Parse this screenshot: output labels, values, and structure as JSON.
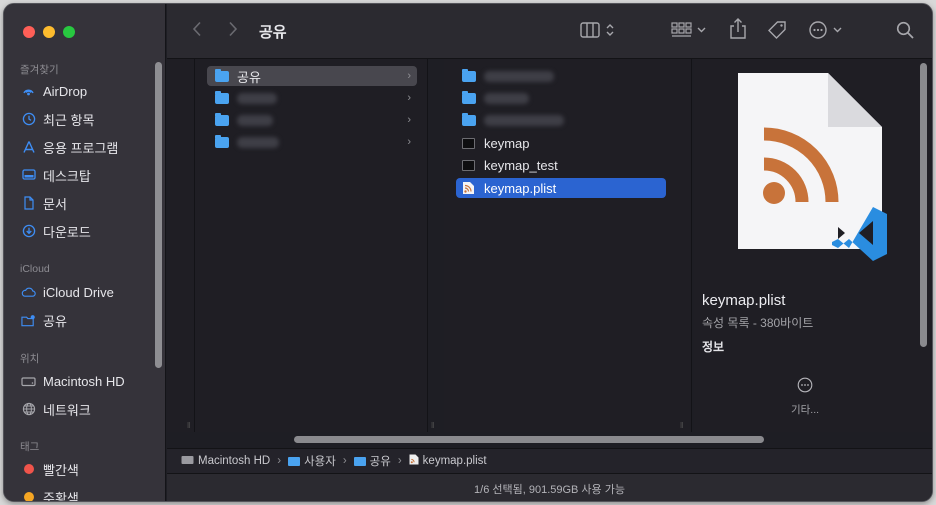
{
  "window": {
    "title": "공유"
  },
  "sidebar": {
    "favorites_header": "즐겨찾기",
    "favorites": [
      {
        "label": "AirDrop",
        "icon": "airdrop-icon"
      },
      {
        "label": "최근 항목",
        "icon": "clock-icon"
      },
      {
        "label": "응용 프로그램",
        "icon": "applications-icon"
      },
      {
        "label": "데스크탑",
        "icon": "desktop-icon"
      },
      {
        "label": "문서",
        "icon": "document-icon"
      },
      {
        "label": "다운로드",
        "icon": "download-icon"
      }
    ],
    "icloud_header": "iCloud",
    "icloud": [
      {
        "label": "iCloud Drive",
        "icon": "cloud-icon"
      },
      {
        "label": "공유",
        "icon": "shared-folder-icon"
      }
    ],
    "locations_header": "위치",
    "locations": [
      {
        "label": "Macintosh HD",
        "icon": "disk-icon"
      },
      {
        "label": "네트워크",
        "icon": "globe-icon"
      }
    ],
    "tags_header": "태그",
    "tags": [
      {
        "label": "빨간색",
        "color": "#f0544b"
      },
      {
        "label": "주황색",
        "color": "#f5a623"
      }
    ]
  },
  "column1": {
    "selected": "공유"
  },
  "column2": {
    "files": [
      {
        "name": "keymap",
        "kind": "exec"
      },
      {
        "name": "keymap_test",
        "kind": "exec"
      },
      {
        "name": "keymap.plist",
        "kind": "plist",
        "selected": true
      }
    ]
  },
  "preview": {
    "filename": "keymap.plist",
    "kind_size": "속성 목록 - 380바이트",
    "info_label": "정보",
    "more_label": "기타..."
  },
  "pathbar": [
    "Macintosh HD",
    "사용자",
    "공유",
    "keymap.plist"
  ],
  "status": "1/6 선택됨, 901.59GB 사용 가능",
  "colors": {
    "accent": "#2b64d1",
    "folder": "#4aa3f0",
    "rss_orange": "#c8733a",
    "vscode_blue": "#2a8de0"
  }
}
